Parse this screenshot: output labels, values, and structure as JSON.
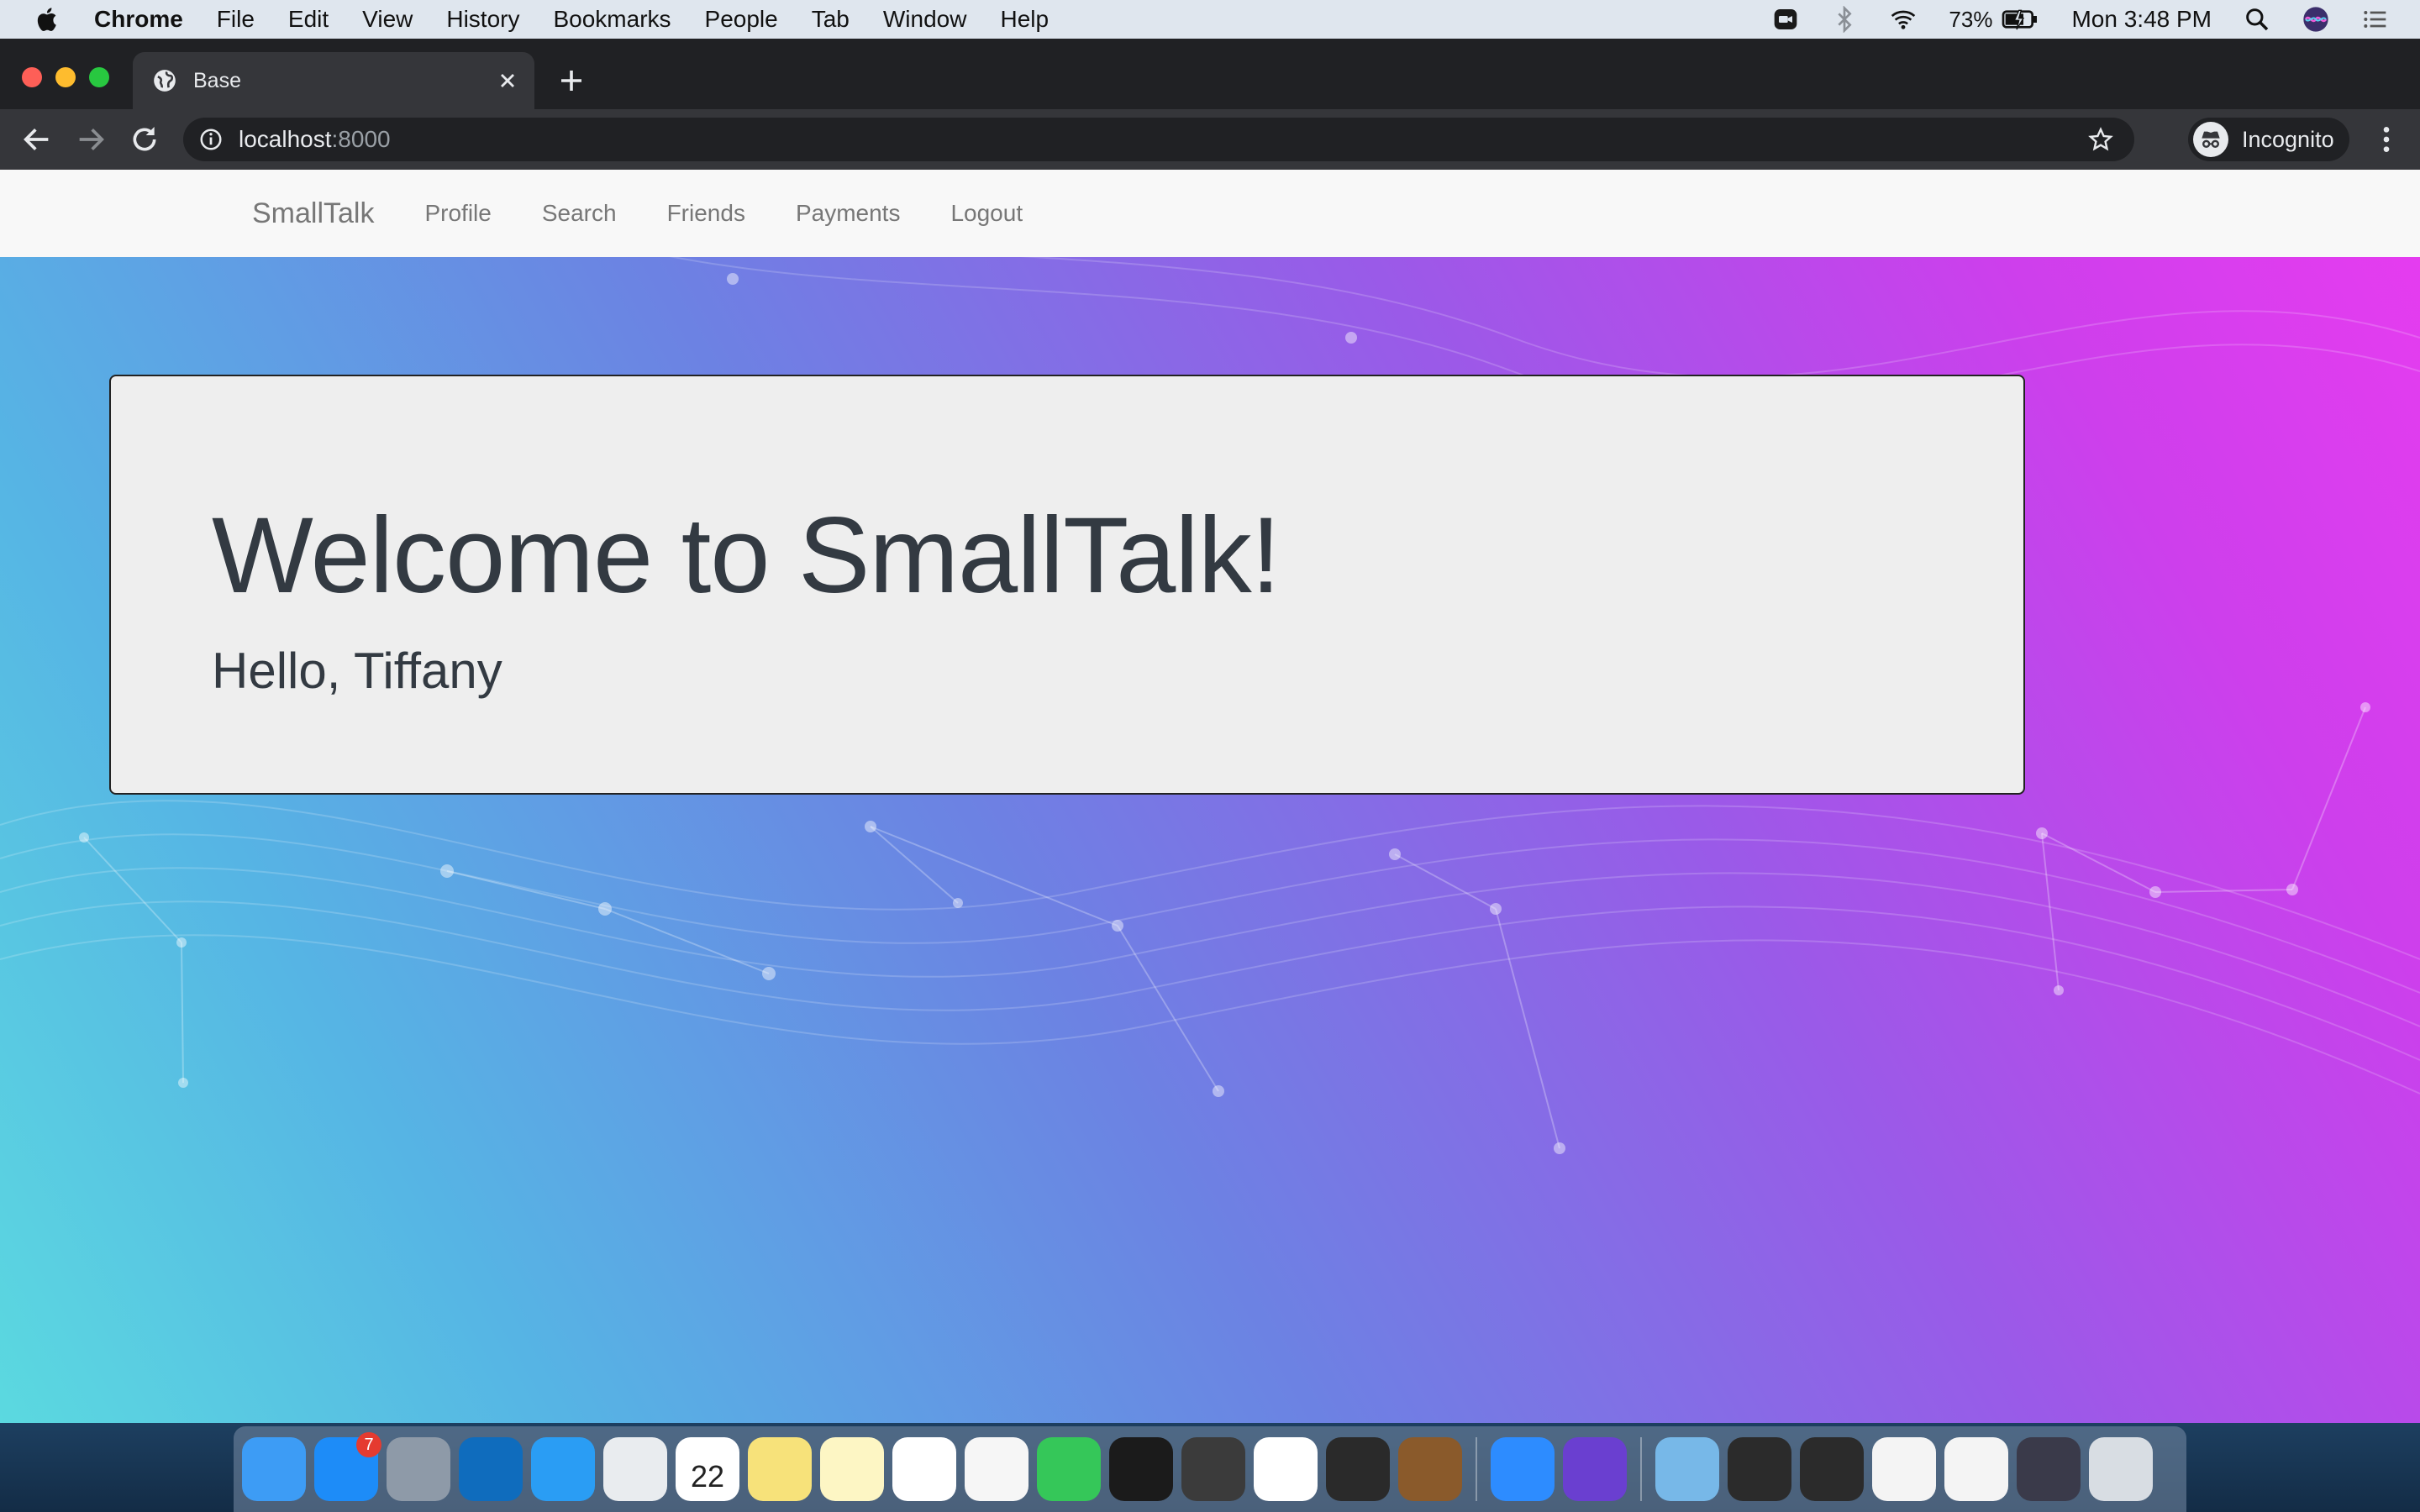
{
  "menubar": {
    "app_name": "Chrome",
    "items": [
      "File",
      "Edit",
      "View",
      "History",
      "Bookmarks",
      "People",
      "Tab",
      "Window",
      "Help"
    ],
    "battery": "73%",
    "clock": "Mon 3:48 PM"
  },
  "browser": {
    "tab_title": "Base",
    "url_host": "localhost",
    "url_port": ":8000",
    "incognito_label": "Incognito"
  },
  "site": {
    "brand": "SmallTalk",
    "nav": [
      "Profile",
      "Search",
      "Friends",
      "Payments",
      "Logout"
    ],
    "heading": "Welcome to SmallTalk!",
    "greeting": "Hello, Tiffany"
  },
  "dock": {
    "apps": [
      {
        "name": "finder-icon",
        "color": "#3d9cf5"
      },
      {
        "name": "app-store-icon",
        "color": "#1d8cf8",
        "badge": "7"
      },
      {
        "name": "launchpad-icon",
        "color": "#8e9aa8"
      },
      {
        "name": "outlook-icon",
        "color": "#0f6cbd"
      },
      {
        "name": "safari-icon",
        "color": "#2a9df4"
      },
      {
        "name": "chrome-icon",
        "color": "#e9ecef"
      },
      {
        "name": "calendar-icon",
        "color": "#ffffff",
        "text": "22"
      },
      {
        "name": "stickies-icon",
        "color": "#f7e27a"
      },
      {
        "name": "notes-icon",
        "color": "#fdf6c4"
      },
      {
        "name": "reminders-icon",
        "color": "#ffffff"
      },
      {
        "name": "photos-icon",
        "color": "#f6f6f6"
      },
      {
        "name": "facetime-icon",
        "color": "#35c759"
      },
      {
        "name": "terminal-icon",
        "color": "#1b1b1b"
      },
      {
        "name": "sublime-text-icon",
        "color": "#3b3b3b"
      },
      {
        "name": "slack-icon",
        "color": "#ffffff"
      },
      {
        "name": "final-cut-icon",
        "color": "#2a2a2a"
      },
      {
        "name": "animal-app-icon",
        "color": "#8a5a2b"
      }
    ],
    "apps2": [
      {
        "name": "zoom-icon",
        "color": "#2d8cff"
      },
      {
        "name": "imovie-icon",
        "color": "#6a3fd0"
      }
    ],
    "docs": [
      {
        "name": "folder-icon",
        "color": "#77b8e8"
      },
      {
        "name": "window-thumbnail-icon",
        "color": "#2b2b2b"
      },
      {
        "name": "window-thumbnail-icon",
        "color": "#2b2b2b"
      },
      {
        "name": "document-thumbnail-icon",
        "color": "#f4f4f4"
      },
      {
        "name": "document-thumbnail-icon",
        "color": "#f4f4f4"
      },
      {
        "name": "window-thumbnail-icon",
        "color": "#3a3a4a"
      },
      {
        "name": "trash-icon",
        "color": "#d8dde3"
      }
    ]
  }
}
